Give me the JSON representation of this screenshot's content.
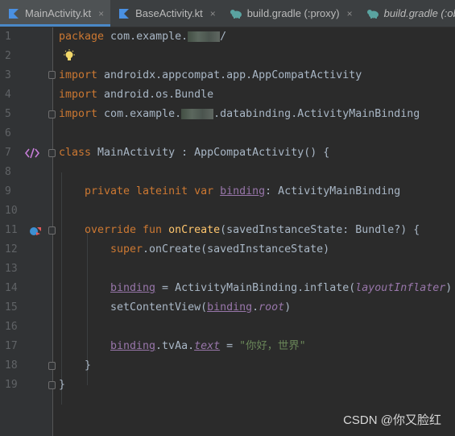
{
  "tabs": [
    {
      "label": "MainActivity.kt",
      "icon": "kotlin-file-icon",
      "active": true
    },
    {
      "label": "BaseActivity.kt",
      "icon": "kotlin-file-icon",
      "active": false
    },
    {
      "label": "build.gradle (:proxy)",
      "icon": "gradle-elephant-icon",
      "active": false
    },
    {
      "label": "build.gradle (:obs",
      "icon": "gradle-elephant-icon",
      "active": false
    }
  ],
  "close_glyph": "×",
  "lines": {
    "l1": {
      "no": "1",
      "a": "package",
      "b": " com.example.",
      "c": "/"
    },
    "l2": {
      "no": "2"
    },
    "l3": {
      "no": "3",
      "a": "import",
      "b": " androidx.appcompat.app.AppCompatActivity"
    },
    "l4": {
      "no": "4",
      "a": "import",
      "b": " android.os.Bundle"
    },
    "l5": {
      "no": "5",
      "a": "import",
      "b": " com.example.",
      "c": ".databinding.ActivityMainBinding"
    },
    "l6": {
      "no": "6"
    },
    "l7": {
      "no": "7",
      "a": "class",
      "b": " MainActivity : AppCompatActivity() {"
    },
    "l8": {
      "no": "8"
    },
    "l9": {
      "no": "9",
      "a": "private lateinit var",
      "sp": " ",
      "p": "binding",
      "b": ": ActivityMainBinding"
    },
    "l10": {
      "no": "10"
    },
    "l11": {
      "no": "11",
      "a": "override fun",
      "sp": " ",
      "f": "onCreate",
      "b": "(savedInstanceState: Bundle?) {"
    },
    "l12": {
      "no": "12",
      "a": "super",
      "b": ".onCreate(savedInstanceState)"
    },
    "l13": {
      "no": "13"
    },
    "l14": {
      "no": "14",
      "p": "binding",
      "b": " = ActivityMainBinding.inflate(",
      "q": "layoutInflater",
      "c": ")"
    },
    "l15": {
      "no": "15",
      "b": "setContentView(",
      "p": "binding",
      "d": ".",
      "q": "root",
      "c": ")"
    },
    "l16": {
      "no": "16"
    },
    "l17": {
      "no": "17",
      "p": "binding",
      "b": ".tvAa.",
      "r": "text",
      "c": " = ",
      "s": "\"你好，世界\""
    },
    "l18": {
      "no": "18",
      "b": "}"
    },
    "l19": {
      "no": "19",
      "b": "}"
    }
  },
  "watermark": "CSDN @你又脸红",
  "colors": {
    "background": "#2b2b2b",
    "keyword": "#cc7832",
    "function": "#ffc66d",
    "property": "#9876aa",
    "string": "#6a8759",
    "text": "#a9b7c6"
  }
}
